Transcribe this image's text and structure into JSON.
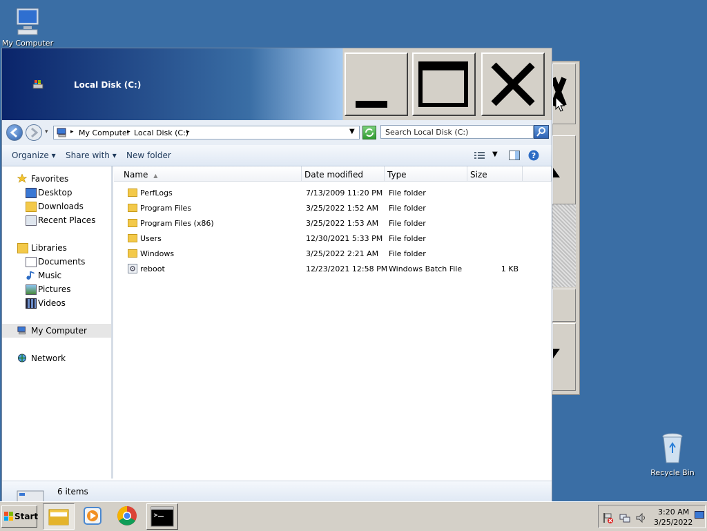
{
  "desktop": {
    "icons": [
      {
        "label": "My Computer"
      },
      {
        "label": "Recycle Bin"
      }
    ]
  },
  "window": {
    "title": "Local Disk (C:)",
    "breadcrumb": [
      "My Computer",
      "Local Disk (C:)"
    ],
    "search_placeholder": "Search Local Disk (C:)",
    "toolbar": {
      "organize": "Organize",
      "share_with": "Share with",
      "new_folder": "New folder"
    },
    "nav": {
      "favorites": "Favorites",
      "favorites_items": [
        "Desktop",
        "Downloads",
        "Recent Places"
      ],
      "libraries": "Libraries",
      "libraries_items": [
        "Documents",
        "Music",
        "Pictures",
        "Videos"
      ],
      "my_computer": "My Computer",
      "network": "Network"
    },
    "columns": {
      "name": "Name",
      "date": "Date modified",
      "type": "Type",
      "size": "Size"
    },
    "files": [
      {
        "name": "PerfLogs",
        "date": "7/13/2009 11:20 PM",
        "type": "File folder",
        "size": ""
      },
      {
        "name": "Program Files",
        "date": "3/25/2022 1:52 AM",
        "type": "File folder",
        "size": ""
      },
      {
        "name": "Program Files (x86)",
        "date": "3/25/2022 1:53 AM",
        "type": "File folder",
        "size": ""
      },
      {
        "name": "Users",
        "date": "12/30/2021 5:33 PM",
        "type": "File folder",
        "size": ""
      },
      {
        "name": "Windows",
        "date": "3/25/2022 2:21 AM",
        "type": "File folder",
        "size": ""
      },
      {
        "name": "reboot",
        "date": "12/23/2021 12:58 PM",
        "type": "Windows Batch File",
        "size": "1 KB"
      }
    ],
    "status": "6 items"
  },
  "taskbar": {
    "start_label": "Start",
    "clock_time": "3:20 AM",
    "clock_date": "3/25/2022"
  }
}
